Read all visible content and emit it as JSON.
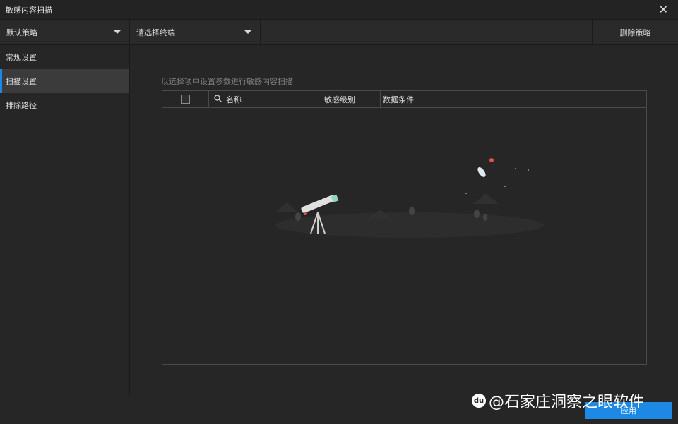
{
  "window": {
    "title": "敏感内容扫描"
  },
  "toolbar": {
    "policy_select": "默认策略",
    "terminal_select": "请选择终端",
    "delete_label": "删除策略"
  },
  "sidebar": {
    "items": [
      {
        "label": "常规设置",
        "active": false
      },
      {
        "label": "扫描设置",
        "active": true
      },
      {
        "label": "排除路径",
        "active": false
      }
    ]
  },
  "main": {
    "hint": "以选择项中设置参数进行敏感内容扫描",
    "table": {
      "columns": [
        "名称",
        "敏感级别",
        "数据条件"
      ],
      "rows": []
    }
  },
  "footer": {
    "apply_label": "应用"
  },
  "watermark": {
    "logo": "du",
    "text": "@石家庄洞察之眼软件"
  },
  "colors": {
    "accent": "#1e88e5",
    "background": "#262626"
  }
}
